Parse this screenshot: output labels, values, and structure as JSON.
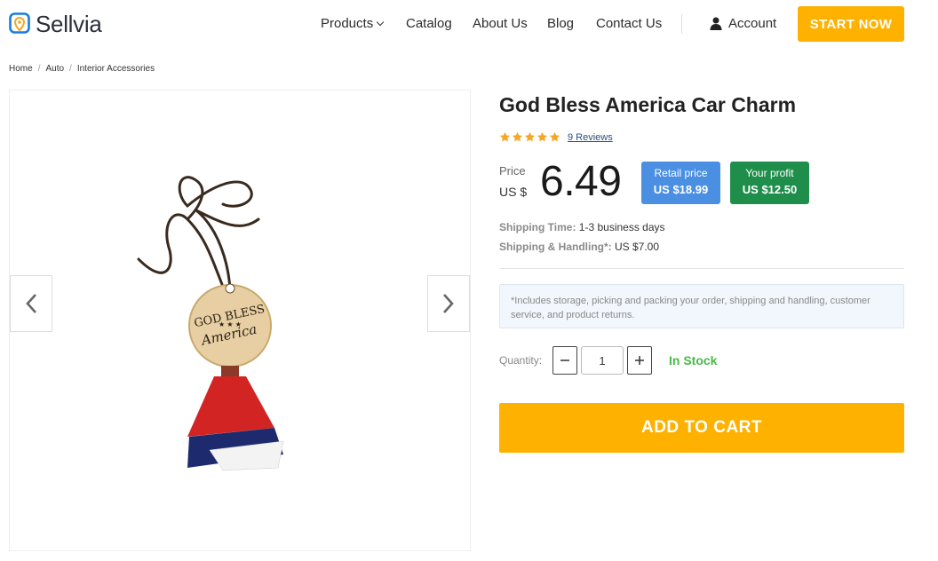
{
  "brand": {
    "name": "Sellvia",
    "color": "#1a7de0"
  },
  "nav": {
    "items": [
      {
        "label": "Products",
        "has_dropdown": true
      },
      {
        "label": "Catalog"
      },
      {
        "label": "About Us"
      },
      {
        "label": "Blog"
      },
      {
        "label": "Contact Us"
      }
    ],
    "account_label": "Account",
    "cta_label": "START NOW"
  },
  "breadcrumb": [
    "Home",
    "Auto",
    "Interior Accessories"
  ],
  "gallery": {
    "image_icon": "car-charm-tassel-image",
    "prev_icon": "chevron-left-icon",
    "next_icon": "chevron-right-icon",
    "charm_text_line1": "GOD BLESS",
    "charm_text_line2": "America"
  },
  "product": {
    "title": "God Bless America Car Charm",
    "rating_stars": 5,
    "reviews_label": "9 Reviews",
    "price_label": "Price",
    "currency_label": "US $",
    "price": "6.49",
    "retail_label": "Retail price",
    "retail_value": "US $18.99",
    "profit_label": "Your profit",
    "profit_value": "US $12.50",
    "shipping_time_key": "Shipping Time:",
    "shipping_time_value": "1-3 business days",
    "shipping_handling_key": "Shipping & Handling*:",
    "shipping_handling_value": "US $7.00",
    "note": "*Includes storage, picking and packing your order, shipping and handling, customer service, and product returns.",
    "quantity_label": "Quantity:",
    "quantity_value": "1",
    "stock_label": "In Stock",
    "add_to_cart_label": "ADD TO CART"
  },
  "colors": {
    "accent": "#ffb100",
    "retail_badge": "#4a8fe2",
    "profit_badge": "#1e8e4a",
    "in_stock": "#4cb84a",
    "star": "#f5a623"
  }
}
